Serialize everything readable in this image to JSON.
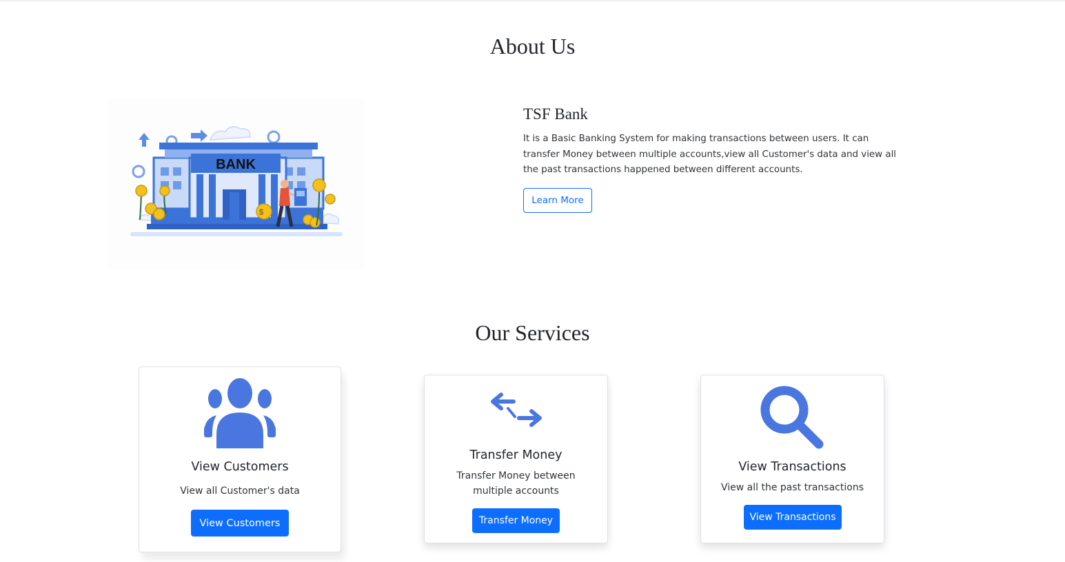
{
  "about": {
    "heading": "About Us",
    "image_sign_text": "BANK",
    "title": "TSF Bank",
    "description": "It is a Basic Banking System for making transactions between users. It can transfer Money between multiple accounts,view all Customer's data and view all the past transactions happened between different accounts.",
    "button_label": "Learn More"
  },
  "services": {
    "heading": "Our Services",
    "cards": [
      {
        "icon": "users-icon",
        "title": "View Customers",
        "text": "View all Customer's data",
        "button_label": "View Customers"
      },
      {
        "icon": "transfer-arrows-icon",
        "title": "Transfer Money",
        "text": "Transfer Money between multiple accounts",
        "button_label": "Transfer Money"
      },
      {
        "icon": "search-icon",
        "title": "View Transactions",
        "text": "View all the past transactions",
        "button_label": "View Transactions"
      }
    ]
  },
  "colors": {
    "primary": "#0d6efd",
    "icon": "#4a76e0",
    "bank_blue": "#3b73d9",
    "coin_gold": "#f2c21b"
  }
}
